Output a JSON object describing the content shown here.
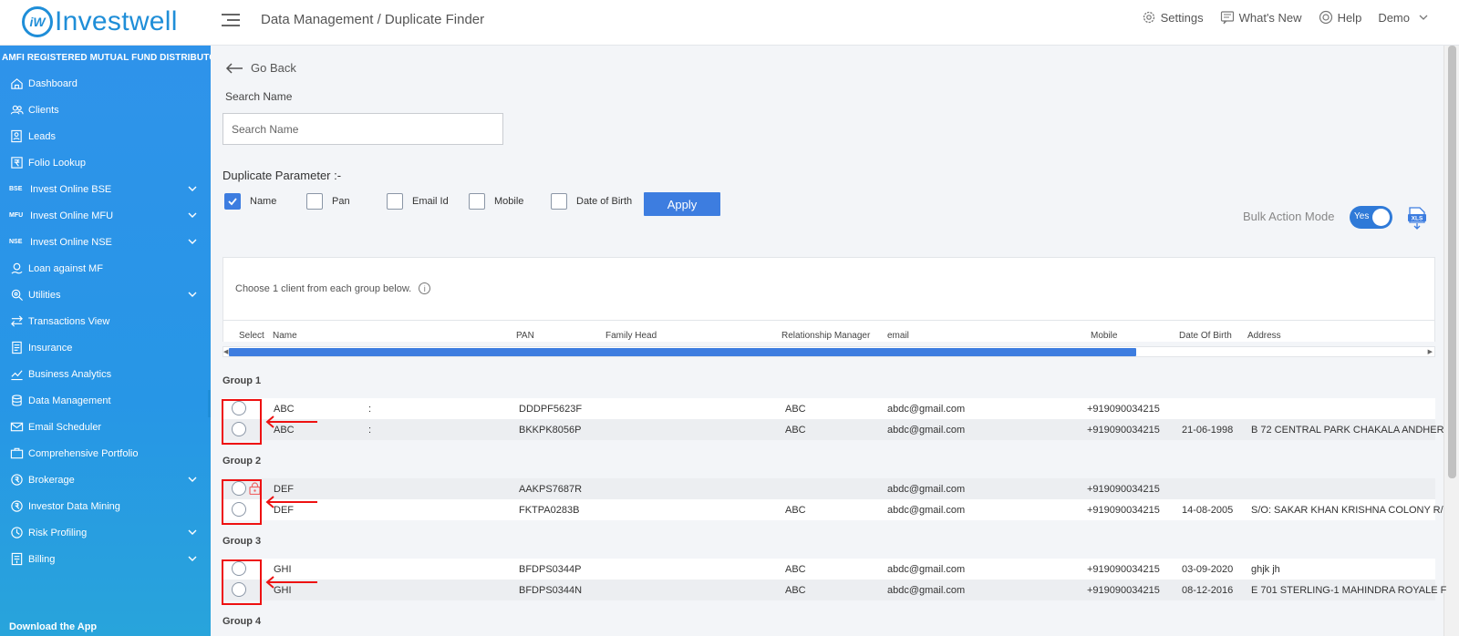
{
  "header": {
    "logo_mark": "iW",
    "logo_text": "Investwell",
    "breadcrumb": "Data Management / Duplicate Finder",
    "actions": [
      {
        "label": "Settings",
        "icon": "gear-icon"
      },
      {
        "label": "What's New",
        "icon": "megaphone-icon"
      },
      {
        "label": "Help",
        "icon": "help-icon"
      }
    ],
    "user": "Demo"
  },
  "sidebar": {
    "amfi": "AMFI REGISTERED MUTUAL FUND DISTRIBUTOR",
    "items": [
      {
        "label": "Dashboard",
        "icon": "home-icon",
        "expandable": false
      },
      {
        "label": "Clients",
        "icon": "users-icon",
        "expandable": false
      },
      {
        "label": "Leads",
        "icon": "leads-icon",
        "expandable": false
      },
      {
        "label": "Folio Lookup",
        "icon": "rupee-doc-icon",
        "expandable": false
      },
      {
        "label": "Invest Online BSE",
        "tag": "BSE",
        "expandable": true
      },
      {
        "label": "Invest Online MFU",
        "tag": "MFU",
        "expandable": true
      },
      {
        "label": "Invest Online NSE",
        "tag": "NSE",
        "expandable": true
      },
      {
        "label": "Loan against MF",
        "icon": "loan-icon",
        "expandable": false
      },
      {
        "label": "Utilities",
        "icon": "utilities-icon",
        "expandable": true
      },
      {
        "label": "Transactions View",
        "icon": "transfer-icon",
        "expandable": false
      },
      {
        "label": "Insurance",
        "icon": "insurance-icon",
        "expandable": false
      },
      {
        "label": "Business Analytics",
        "icon": "analytics-icon",
        "expandable": false
      },
      {
        "label": "Data Management",
        "icon": "database-icon",
        "expandable": false
      },
      {
        "label": "Email Scheduler",
        "icon": "email-icon",
        "expandable": false
      },
      {
        "label": "Comprehensive Portfolio",
        "icon": "briefcase-icon",
        "expandable": false
      },
      {
        "label": "Brokerage",
        "icon": "brokerage-icon",
        "expandable": true
      },
      {
        "label": "Investor Data Mining",
        "icon": "mining-icon",
        "expandable": false
      },
      {
        "label": "Risk Profiling",
        "icon": "risk-icon",
        "expandable": true
      },
      {
        "label": "Billing",
        "icon": "billing-icon",
        "expandable": true
      }
    ],
    "download": "Download the App"
  },
  "main": {
    "go_back": "Go Back",
    "search_label": "Search Name",
    "search_placeholder": "Search Name",
    "dup_label": "Duplicate Parameter :-",
    "params": [
      {
        "label": "Name",
        "checked": true
      },
      {
        "label": "Pan",
        "checked": false
      },
      {
        "label": "Email Id",
        "checked": false
      },
      {
        "label": "Mobile",
        "checked": false
      },
      {
        "label": "Date of Birth",
        "checked": false
      }
    ],
    "apply": "Apply",
    "bulk_label": "Bulk Action Mode",
    "bulk_toggle": "Yes",
    "xls_label": "XLS",
    "instruction": "Choose 1 client from each group below.",
    "columns": [
      "Select",
      "Name",
      "PAN",
      "Family Head",
      "Relationship Manager",
      "email",
      "Mobile",
      "Date Of Birth",
      "Address"
    ],
    "groups": [
      {
        "title": "Group 1",
        "rows": [
          {
            "name": "ABC",
            "sep": ":",
            "pan": "DDDPF5623F",
            "rm": "ABC",
            "email": "abdc@gmail.com",
            "mobile": "+919090034215",
            "dob": "",
            "address": "",
            "locked": false
          },
          {
            "name": "ABC",
            "sep": ":",
            "pan": "BKKPK8056P",
            "rm": "ABC",
            "email": "abdc@gmail.com",
            "mobile": "+919090034215",
            "dob": "21-06-1998",
            "address": "B 72 CENTRAL PARK CHAKALA ANDHER",
            "locked": false
          }
        ]
      },
      {
        "title": "Group 2",
        "rows": [
          {
            "name": "DEF",
            "sep": "",
            "pan": "AAKPS7687R",
            "rm": "",
            "email": "abdc@gmail.com",
            "mobile": "+919090034215",
            "dob": "",
            "address": "",
            "locked": true
          },
          {
            "name": "DEF",
            "sep": "",
            "pan": "FKTPA0283B",
            "rm": "ABC",
            "email": "abdc@gmail.com",
            "mobile": "+919090034215",
            "dob": "14-08-2005",
            "address": "S/O: SAKAR KHAN KRISHNA COLONY R/",
            "locked": false
          }
        ]
      },
      {
        "title": "Group 3",
        "rows": [
          {
            "name": "GHI",
            "sep": "",
            "pan": "BFDPS0344P",
            "rm": "ABC",
            "email": "abdc@gmail.com",
            "mobile": "+919090034215",
            "dob": "03-09-2020",
            "address": "ghjk jh",
            "locked": false
          },
          {
            "name": "GHI",
            "sep": "",
            "pan": "BFDPS0344N",
            "rm": "ABC",
            "email": "abdc@gmail.com",
            "mobile": "+919090034215",
            "dob": "08-12-2016",
            "address": "E 701 STERLING-1 MAHINDRA ROYALE F",
            "locked": false
          }
        ]
      },
      {
        "title": "Group 4",
        "rows": []
      }
    ]
  }
}
